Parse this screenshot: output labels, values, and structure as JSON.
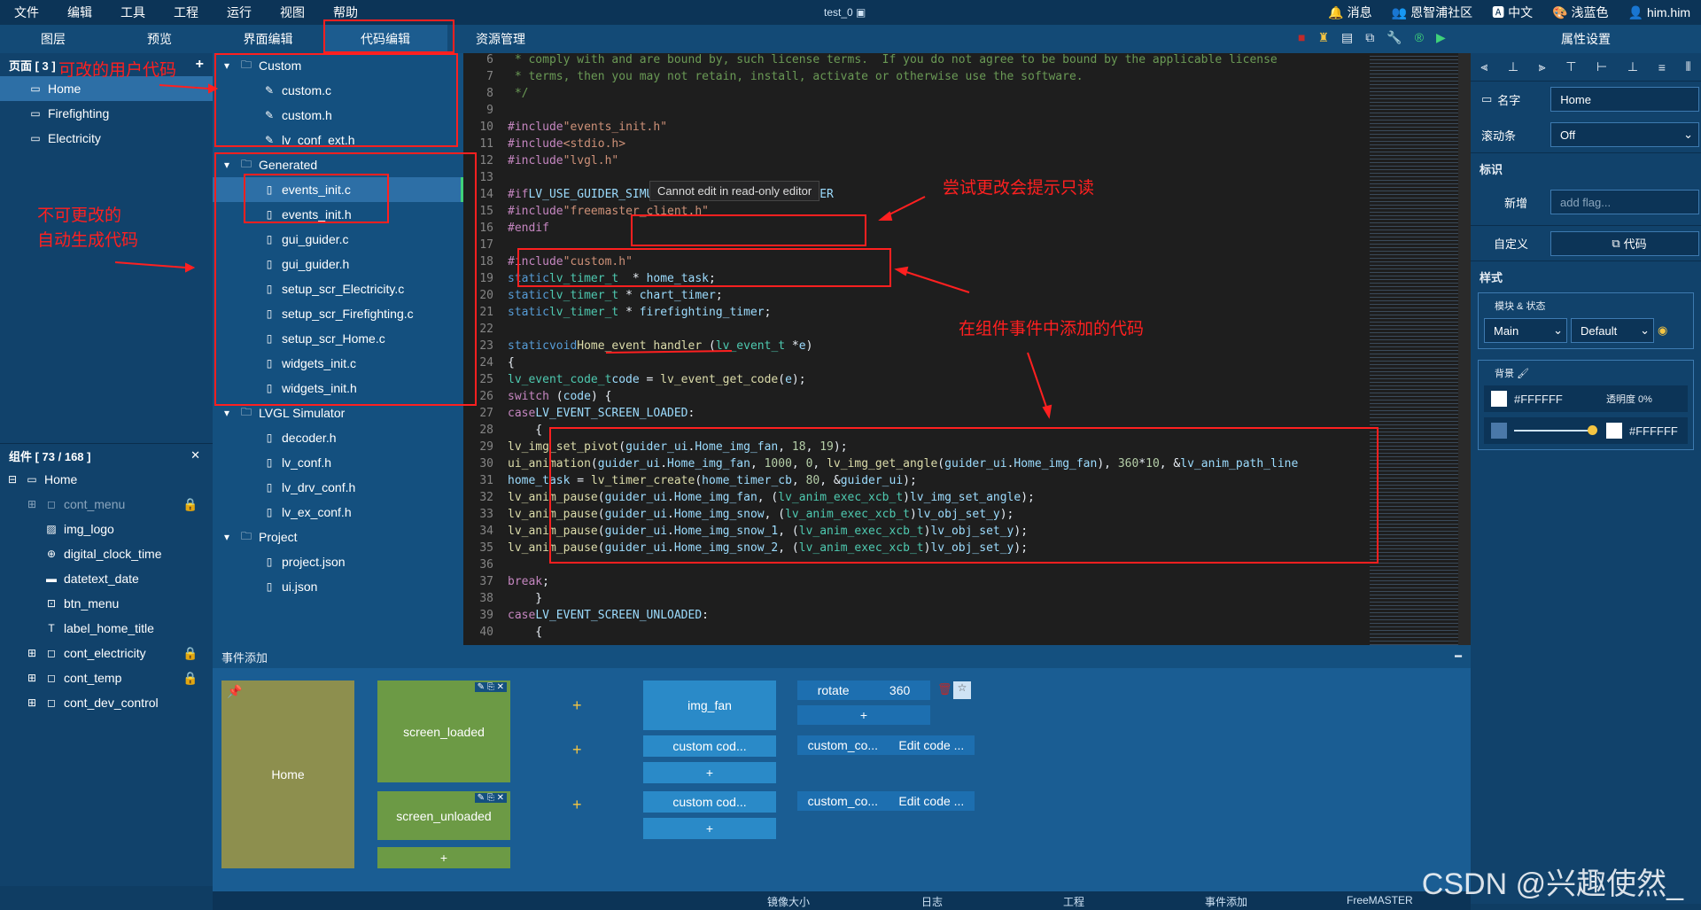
{
  "menu": [
    "文件",
    "编辑",
    "工具",
    "工程",
    "运行",
    "视图",
    "帮助"
  ],
  "window_title": "test_0",
  "menu_right": [
    "消息",
    "恩智浦社区",
    "中文",
    "浅蓝色",
    "him.him"
  ],
  "tabs": {
    "layers": "图层",
    "preview": "预览",
    "ui_edit": "界面编辑",
    "code_edit": "代码编辑",
    "resources": "资源管理",
    "props": "属性设置"
  },
  "pages": {
    "header": "页面 [ 3 ]",
    "items": [
      "Home",
      "Firefighting",
      "Electricity"
    ]
  },
  "components": {
    "header": "组件 [ 73 / 168 ]",
    "root": "Home",
    "items": [
      "cont_menu",
      "img_logo",
      "digital_clock_time",
      "datetext_date",
      "btn_menu",
      "label_home_title",
      "cont_electricity",
      "cont_temp",
      "cont_dev_control"
    ]
  },
  "files": {
    "custom": {
      "name": "Custom",
      "items": [
        "custom.c",
        "custom.h",
        "lv_conf_ext.h"
      ]
    },
    "generated": {
      "name": "Generated",
      "items": [
        "events_init.c",
        "events_init.h",
        "gui_guider.c",
        "gui_guider.h",
        "setup_scr_Electricity.c",
        "setup_scr_Firefighting.c",
        "setup_scr_Home.c",
        "widgets_init.c",
        "widgets_init.h"
      ]
    },
    "simulator": {
      "name": "LVGL Simulator",
      "items": [
        "decoder.h",
        "lv_conf.h",
        "lv_drv_conf.h",
        "lv_ex_conf.h"
      ]
    },
    "project": {
      "name": "Project",
      "items": [
        "project.json",
        "ui.json"
      ]
    }
  },
  "annotations": {
    "user_code": "可改的用户代码",
    "auto_code_1": "不可更改的",
    "auto_code_2": "自动生成代码",
    "readonly_hint": "尝试更改会提示只读",
    "event_code": "在组件事件中添加的代码"
  },
  "tooltip": "Cannot edit in read-only editor",
  "props": {
    "name_label": "名字",
    "name_value": "Home",
    "scroll_label": "滚动条",
    "scroll_value": "Off",
    "flag_header": "标识",
    "add_label": "新增",
    "add_placeholder": "add flag...",
    "custom_label": "自定义",
    "code_btn": "代码",
    "style_header": "样式",
    "part_state": "模块 & 状态",
    "part": "Main",
    "state": "Default",
    "bg_label": "背景",
    "bg_color": "#FFFFFF",
    "opacity": "透明度 0%",
    "grad_color": "#FFFFFF"
  },
  "events": {
    "title": "事件添加",
    "screen": "Home",
    "triggers": [
      "screen_loaded",
      "screen_unloaded"
    ],
    "action_img": "img_fan",
    "action_custom": "custom cod...",
    "rotate_label": "rotate",
    "rotate_value": "360",
    "custom_short": "custom_co...",
    "edit_code": "Edit code ..."
  },
  "status_tabs": [
    "镜像大小",
    "日志",
    "工程",
    "事件添加",
    "FreeMASTER"
  ],
  "watermark": "CSDN @兴趣使然_"
}
